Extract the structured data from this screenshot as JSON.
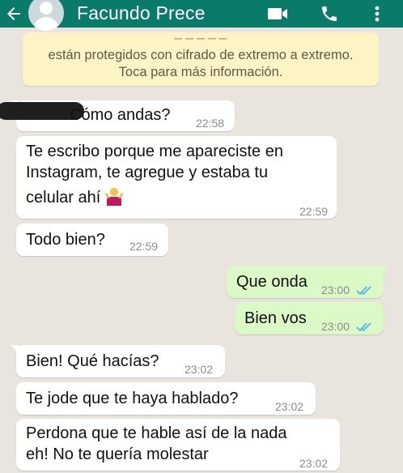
{
  "header": {
    "contact_name": "Facundo Prece",
    "background": "#0a7a69",
    "icons": [
      "back-arrow-icon",
      "avatar",
      "video-call-icon",
      "voice-call-icon",
      "more-options-icon"
    ]
  },
  "notice": {
    "line1": "están protegidos con cifrado de extremo a extremo.",
    "line2": "Toca para más información.",
    "background": "#fdf4c5"
  },
  "messages": [
    {
      "direction": "in",
      "text": "Cómo andas?",
      "time": "22:58",
      "redacted_prefix": true
    },
    {
      "direction": "in",
      "lines": [
        "Te escribo porque me apareciste en",
        "Instagram, te agregue y estaba tu",
        "celular ahí"
      ],
      "emoji": "person-shrugging-emoji",
      "time": "22:59"
    },
    {
      "direction": "in",
      "text": "Todo bien?",
      "time": "22:59"
    },
    {
      "direction": "out",
      "text": "Que onda",
      "time": "23:00",
      "status": "read-double-check-icon"
    },
    {
      "direction": "out",
      "text": "Bien vos",
      "time": "23:00",
      "status": "read-double-check-icon"
    },
    {
      "direction": "in",
      "text": "Bien! Qué hacías?",
      "time": "23:02"
    },
    {
      "direction": "in",
      "text": "Te jode que te haya hablado?",
      "time": "23:02"
    },
    {
      "direction": "in",
      "lines": [
        "Perdona que te hable así de la nada",
        "eh! No te quería molestar"
      ],
      "time": "23:02"
    }
  ],
  "colors": {
    "incoming_bubble": "#ffffff",
    "outgoing_bubble": "#dbf8c7",
    "chat_background": "#e9e4de",
    "read_ticks": "#4fb6ec"
  }
}
